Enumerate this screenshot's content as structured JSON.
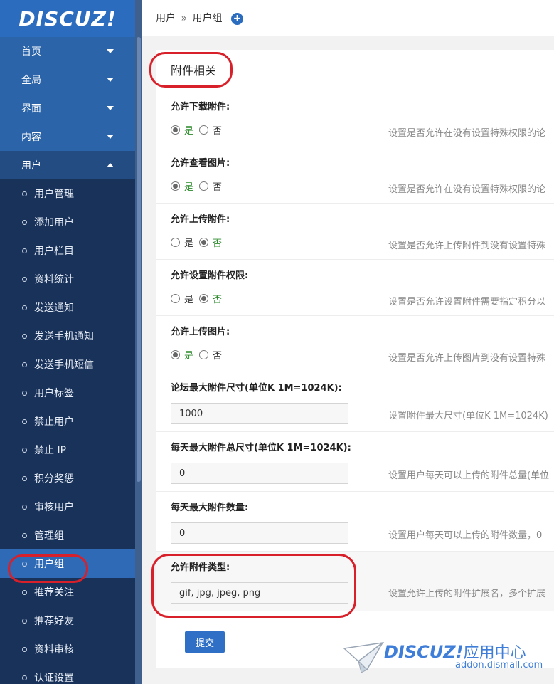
{
  "logo": {
    "text": "DISCUZ!"
  },
  "sidebar": {
    "top_items": [
      {
        "label": "首页"
      },
      {
        "label": "全局"
      },
      {
        "label": "界面"
      },
      {
        "label": "内容"
      },
      {
        "label": "用户"
      }
    ],
    "sub_items": [
      {
        "label": "用户管理"
      },
      {
        "label": "添加用户"
      },
      {
        "label": "用户栏目"
      },
      {
        "label": "资料统计"
      },
      {
        "label": "发送通知"
      },
      {
        "label": "发送手机通知"
      },
      {
        "label": "发送手机短信"
      },
      {
        "label": "用户标签"
      },
      {
        "label": "禁止用户"
      },
      {
        "label": "禁止 IP"
      },
      {
        "label": "积分奖惩"
      },
      {
        "label": "审核用户"
      },
      {
        "label": "管理组"
      },
      {
        "label": "用户组"
      },
      {
        "label": "推荐关注"
      },
      {
        "label": "推荐好友"
      },
      {
        "label": "资料审核"
      },
      {
        "label": "认证设置"
      }
    ]
  },
  "header": {
    "crumb1": "用户",
    "sep": "»",
    "crumb2": "用户组",
    "add_icon": "+"
  },
  "panel": {
    "title": "附件相关",
    "rows": [
      {
        "label": "允许下载附件:",
        "yes": "是",
        "no": "否",
        "selected": "yes",
        "desc": "设置是否允许在没有设置特殊权限的论"
      },
      {
        "label": "允许查看图片:",
        "yes": "是",
        "no": "否",
        "selected": "yes",
        "desc": "设置是否允许在没有设置特殊权限的论"
      },
      {
        "label": "允许上传附件:",
        "yes": "是",
        "no": "否",
        "selected": "no",
        "desc": "设置是否允许上传附件到没有设置特殊"
      },
      {
        "label": "允许设置附件权限:",
        "yes": "是",
        "no": "否",
        "selected": "no",
        "desc": "设置是否允许设置附件需要指定积分以"
      },
      {
        "label": "允许上传图片:",
        "yes": "是",
        "no": "否",
        "selected": "yes",
        "desc": "设置是否允许上传图片到没有设置特殊"
      },
      {
        "label": "论坛最大附件尺寸(单位K 1M=1024K):",
        "value": "1000",
        "desc": "设置附件最大尺寸(单位K 1M=1024K)"
      },
      {
        "label": "每天最大附件总尺寸(单位K 1M=1024K):",
        "value": "0",
        "desc": "设置用户每天可以上传的附件总量(单位"
      },
      {
        "label": "每天最大附件数量:",
        "value": "0",
        "desc": "设置用户每天可以上传的附件数量，0"
      },
      {
        "label": "允许附件类型:",
        "value": "gif, jpg, jpeg, png",
        "desc": "设置允许上传的附件扩展名，多个扩展"
      }
    ],
    "submit_label": "提交"
  },
  "watermark": {
    "brand": "DISCUZ!",
    "brand_cn": "应用中心",
    "url": "addon.dismall.com"
  },
  "colors": {
    "sidebar_bg": "#19325a",
    "sidebar_top_bg": "#2b64a8",
    "logo_bg": "#2b6cbf",
    "active_bg": "#2e6ab5",
    "selected_green": "#2b8a2b",
    "highlight_red": "#d8202a",
    "button_blue": "#2f70c6"
  }
}
